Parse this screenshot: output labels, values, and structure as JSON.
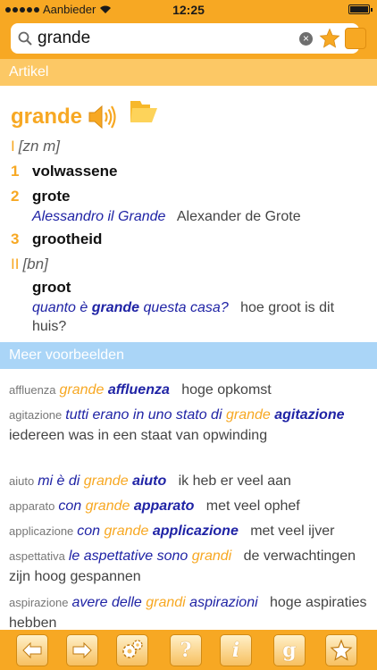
{
  "status": {
    "carrier": "Aanbieder",
    "time": "12:25"
  },
  "search": {
    "value": "grande",
    "placeholder": ""
  },
  "sections": {
    "article_title": "Artikel",
    "more_examples_title": "Meer voorbeelden"
  },
  "article": {
    "headword": "grande",
    "part1": {
      "roman": "I",
      "pos": "[zn m]"
    },
    "senses": [
      {
        "num": "1",
        "text": "volwassene"
      },
      {
        "num": "2",
        "text": "grote"
      },
      {
        "num": "3",
        "text": "grootheid"
      }
    ],
    "sense2_example": {
      "it": "Alessandro il Grande",
      "tr": "Alexander de Grote"
    },
    "part2": {
      "roman": "II",
      "pos": "[bn]"
    },
    "adj_sense": "groot",
    "adj_example": {
      "it_pre": "quanto è",
      "it_bold": "grande",
      "it_post": "questa casa?",
      "tr": "hoe groot is dit huis?"
    }
  },
  "examples": [
    {
      "key": "affluenza",
      "parts": [
        {
          "s": "grande",
          "c": "o"
        },
        {
          "s": " "
        },
        {
          "s": "affluenza",
          "c": "b"
        }
      ],
      "tr": "hoge opkomst"
    },
    {
      "key": "agitazione",
      "parts": [
        {
          "s": "tutti erano in uno stato di",
          "c": "i"
        },
        {
          "s": " "
        },
        {
          "s": "grande",
          "c": "o"
        },
        {
          "s": " "
        },
        {
          "s": "agitazione",
          "c": "b"
        }
      ],
      "tr": "iedereen was in een staat van opwinding"
    },
    {
      "key": "aiuto",
      "parts": [
        {
          "s": "mi è di",
          "c": "i"
        },
        {
          "s": " "
        },
        {
          "s": "grande",
          "c": "o"
        },
        {
          "s": " "
        },
        {
          "s": "aiuto",
          "c": "b"
        }
      ],
      "tr": "ik heb er veel aan"
    },
    {
      "key": "apparato",
      "parts": [
        {
          "s": "con",
          "c": "i"
        },
        {
          "s": " "
        },
        {
          "s": "grande",
          "c": "o"
        },
        {
          "s": " "
        },
        {
          "s": "apparato",
          "c": "b"
        }
      ],
      "tr": "met veel ophef"
    },
    {
      "key": "applicazione",
      "parts": [
        {
          "s": "con",
          "c": "i"
        },
        {
          "s": " "
        },
        {
          "s": "grande",
          "c": "o"
        },
        {
          "s": " "
        },
        {
          "s": "applicazione",
          "c": "b"
        }
      ],
      "tr": "met veel ijver"
    },
    {
      "key": "aspettativa",
      "parts": [
        {
          "s": "le aspettative sono",
          "c": "i"
        },
        {
          "s": " "
        },
        {
          "s": "grandi",
          "c": "o"
        }
      ],
      "tr": "de verwachtingen zijn hoog gespannen"
    },
    {
      "key": "aspirazione",
      "parts": [
        {
          "s": "avere delle",
          "c": "i"
        },
        {
          "s": " "
        },
        {
          "s": "grandi",
          "c": "o"
        },
        {
          "s": " "
        },
        {
          "s": "aspirazioni",
          "c": "i"
        }
      ],
      "tr": "hoge aspiraties hebben"
    }
  ],
  "toolbar": {
    "info_glyph": "i",
    "help_glyph": "?",
    "g_glyph": "g"
  },
  "colors": {
    "accent": "#f7a823",
    "header_orange": "#fcc865",
    "header_blue": "#aad5f7",
    "italian_blue": "#1f23a5"
  }
}
